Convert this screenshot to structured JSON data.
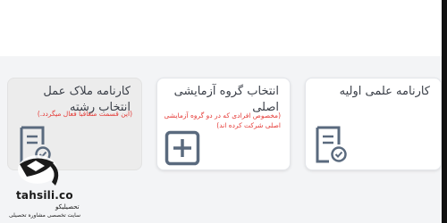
{
  "cards": [
    {
      "title": "کارنامه علمی اولیه",
      "note": "",
      "icon": "certificate-icon",
      "state": "enabled"
    },
    {
      "title": "انتخاب گروه آزمایشی اصلی",
      "note": "(مخصوص افرادی که در دو گروه آزمایشی اصلی شرکت کرده اند)",
      "icon": "add-box-icon",
      "state": "enabled"
    },
    {
      "title": "کارنامه ملاک عمل انتخاب رشته",
      "note": "(این قسمت متعاقبا فعال میگردد.)",
      "icon": "certificate-icon",
      "state": "disabled"
    }
  ],
  "colors": {
    "note": "#e53935",
    "icon": "#5a6a7e",
    "title": "#3a3f48"
  },
  "watermark": {
    "brand": "tahsili.co",
    "brand_fa": "تحصیلیکو",
    "subtitle": "سایت تخصصی مشاوره تحصیلی"
  }
}
